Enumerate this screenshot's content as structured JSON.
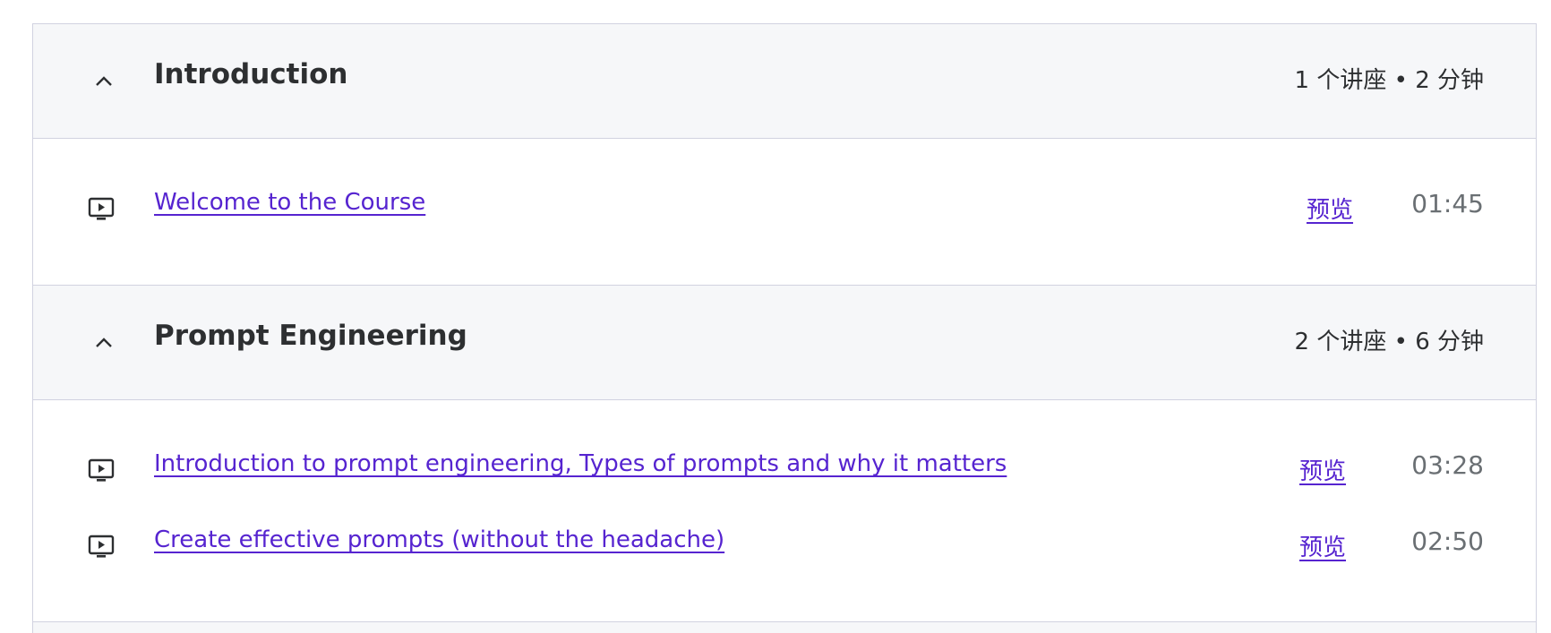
{
  "sections": [
    {
      "title": "Introduction",
      "meta": "1 个讲座 • 2 分钟",
      "expanded": true,
      "lectures": [
        {
          "title": "Welcome to the Course",
          "preview": "预览",
          "duration": "01:45",
          "icon": "play-video-icon"
        }
      ]
    },
    {
      "title": "Prompt Engineering",
      "meta": "2 个讲座 • 6 分钟",
      "expanded": true,
      "lectures": [
        {
          "title": "Introduction to prompt engineering, Types of prompts and why it matters",
          "preview": "预览",
          "duration": "03:28",
          "icon": "play-video-icon"
        },
        {
          "title": "Create effective prompts (without the headache)",
          "preview": "预览",
          "duration": "02:50",
          "icon": "play-video-icon"
        }
      ]
    }
  ],
  "colors": {
    "link": "#5624d0",
    "text": "#2d2f31",
    "muted": "#6a6f73",
    "header_bg": "#f6f7f9",
    "border": "#d1d2e0"
  }
}
